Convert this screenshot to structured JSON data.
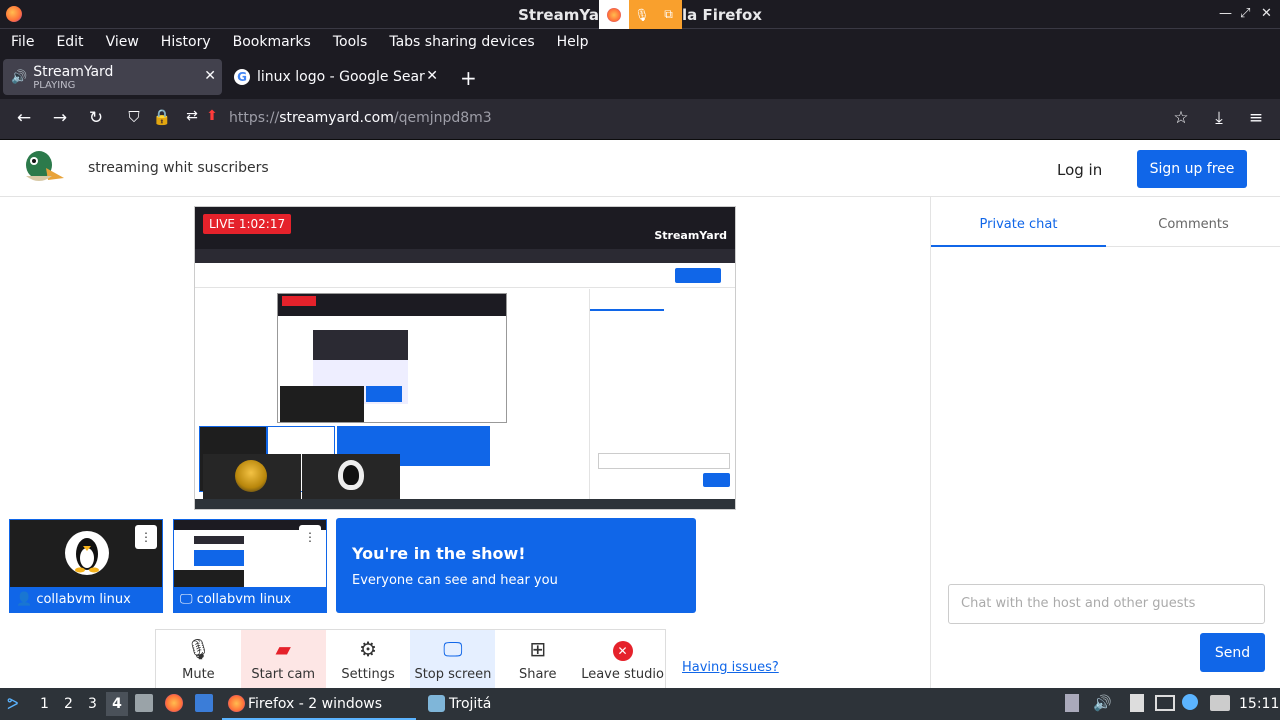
{
  "window": {
    "title": "StreamYard - Mozilla Firefox",
    "title_visible_left": "StreamYa",
    "title_visible_right": "la Firefox"
  },
  "menu": [
    "File",
    "Edit",
    "View",
    "History",
    "Bookmarks",
    "Tools",
    "Tabs sharing devices",
    "Help"
  ],
  "tabs": [
    {
      "title": "StreamYard",
      "subtitle": "PLAYING"
    },
    {
      "title": "linux logo - Google Search"
    }
  ],
  "address": {
    "prefix": "https://",
    "domain": "streamyard.com",
    "path": "/qemjnpd8m3"
  },
  "page": {
    "broadcast_title": "streaming whit suscribers",
    "login": "Log in",
    "signup": "Sign up free",
    "live_badge": "LIVE 1:02:17",
    "participants": [
      {
        "name": "collabvm linux",
        "type": "camera"
      },
      {
        "name": "collabvm linux",
        "type": "screen"
      }
    ],
    "show_banner": {
      "heading": "You're in the show!",
      "sub": "Everyone can see and hear you"
    },
    "controls": [
      "Mute",
      "Start cam",
      "Settings",
      "Stop screen",
      "Share",
      "Leave studio"
    ],
    "issues": "Having issues?",
    "sidebar": {
      "tabs": [
        "Private chat",
        "Comments"
      ],
      "placeholder": "Chat with the host and other guests",
      "send": "Send"
    }
  },
  "taskbar": {
    "workspaces": [
      "1",
      "2",
      "3",
      "4"
    ],
    "task1": "Firefox - 2 windows",
    "task2": "Trojitá",
    "clock": "15:11"
  },
  "colors": {
    "accent": "#1066e8",
    "live": "#e5222b",
    "chrome": "#1c1b22"
  }
}
